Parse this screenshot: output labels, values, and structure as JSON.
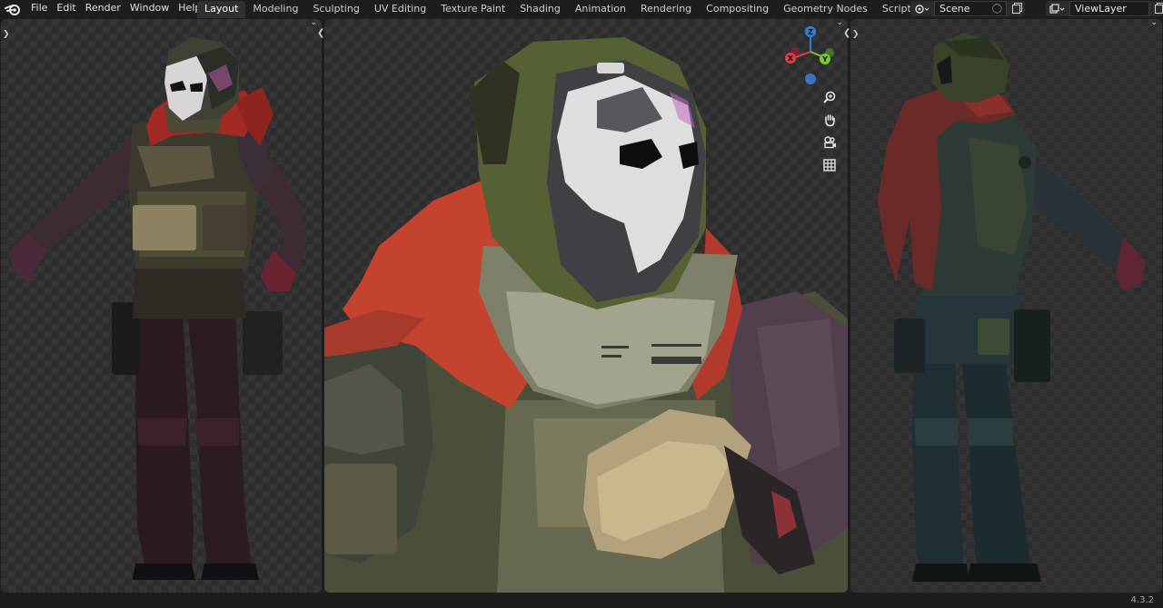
{
  "menu": {
    "items": [
      {
        "name": "menu-file",
        "label": "File"
      },
      {
        "name": "menu-edit",
        "label": "Edit"
      },
      {
        "name": "menu-render",
        "label": "Render"
      },
      {
        "name": "menu-window",
        "label": "Window"
      },
      {
        "name": "menu-help",
        "label": "Help"
      }
    ]
  },
  "workspaces": {
    "tabs": [
      {
        "label": "Layout",
        "active": true
      },
      {
        "label": "Modeling"
      },
      {
        "label": "Sculpting"
      },
      {
        "label": "UV Editing"
      },
      {
        "label": "Texture Paint"
      },
      {
        "label": "Shading"
      },
      {
        "label": "Animation"
      },
      {
        "label": "Rendering"
      },
      {
        "label": "Compositing"
      },
      {
        "label": "Geometry Nodes"
      },
      {
        "label": "Scripting"
      }
    ],
    "add_label": "+"
  },
  "scene": {
    "name": "Scene"
  },
  "view_layer": {
    "name": "ViewLayer"
  },
  "gizmo": {
    "z": "Z",
    "x": "X",
    "y": "Y",
    "colors": {
      "x": "#e03a4d",
      "y": "#7ec62b",
      "z": "#2d7fdc"
    }
  },
  "status": {
    "version": "4.3.2"
  },
  "colors": {
    "accent": "#303030",
    "background": "#1d1d1d"
  }
}
